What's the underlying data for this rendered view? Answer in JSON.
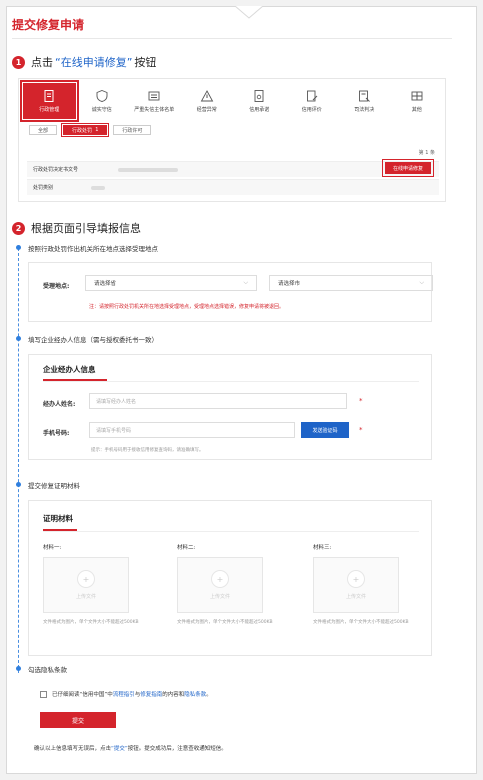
{
  "page_title": "提交修复申请",
  "step1": {
    "num": "1",
    "prefix": "点击",
    "highlight": "“在线申请修复”",
    "suffix": "按钮"
  },
  "mock": {
    "categories": [
      {
        "label": "行政管理",
        "icon": "doc-icon"
      },
      {
        "label": "诚实守信",
        "icon": "shield-icon"
      },
      {
        "label": "严重失信主体名单",
        "icon": "list-icon"
      },
      {
        "label": "经营异常",
        "icon": "alert-icon"
      },
      {
        "label": "信用承诺",
        "icon": "promise-icon"
      },
      {
        "label": "信用评价",
        "icon": "rating-icon"
      },
      {
        "label": "司法判决",
        "icon": "judgment-icon"
      },
      {
        "label": "其他",
        "icon": "other-icon"
      }
    ],
    "subtabs": {
      "all": "全部",
      "penalty": "行政处罚",
      "penalty_count": "1",
      "license": "行政许可"
    },
    "count": "第 1 条",
    "row1_label": "行政处罚决定书文号",
    "row2_label": "处罚类别",
    "repair_button": "在线申请修复"
  },
  "step2": {
    "num": "2",
    "text": "根据页面引导填报信息"
  },
  "timeline": {
    "t1": "按照行政处罚作出机关所在地点选择受理地点",
    "t2": "填写企业经办人信息（需与授权委托书一致）",
    "t3": "提交修复证明材料",
    "t4": "勾选隐私条款"
  },
  "location": {
    "label": "受理地点:",
    "province_placeholder": "请选择省",
    "city_placeholder": "请选择市",
    "note": "注：请按照行政处罚机关所在地选择受理地点，受理地点选择错误，修复申请将被退回。"
  },
  "agent": {
    "title": "企业经办人信息",
    "name_label": "经办人姓名:",
    "name_placeholder": "请填写经办人姓名",
    "phone_label": "手机号码:",
    "phone_placeholder": "请填写手机号码",
    "code_button": "发送验证码",
    "hint": "提示：手机号码用于接收信用修复查询码，请准确填写。"
  },
  "materials": {
    "title": "证明材料",
    "m1": "材料一:",
    "m2": "材料二:",
    "m3": "材料三:",
    "upload": "上传文件",
    "fmt1": "文件格式为图片，单个文件大小不能超过500KB",
    "fmt2": "文件格式为图片，单个文件大小不能超过500KB",
    "fmt3": "文件格式为图片，单个文件大小不能超过500KB"
  },
  "agree": {
    "pre": "已仔细阅读“信用中国”中",
    "link1": "流程指引",
    "mid1": "与",
    "link2": "修复指南",
    "mid2": "的内容和",
    "link3": "隐私条款",
    "end": "。"
  },
  "submit": "提交",
  "footer": {
    "pre": "确认以上信息填写无误后，点击",
    "link": "“提交”",
    "post": "按钮。提交成功后，注意查收通知短信。"
  },
  "colors": {
    "accent": "#d4242c",
    "link": "#1f64c8"
  }
}
